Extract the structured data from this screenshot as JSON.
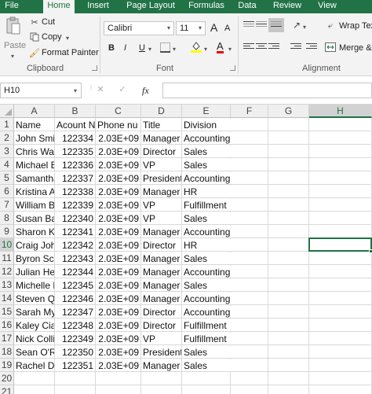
{
  "ribbon_tabs": [
    {
      "label": "File",
      "active": false
    },
    {
      "label": "Home",
      "active": true
    },
    {
      "label": "Insert",
      "active": false
    },
    {
      "label": "Page Layout",
      "active": false
    },
    {
      "label": "Formulas",
      "active": false
    },
    {
      "label": "Data",
      "active": false
    },
    {
      "label": "Review",
      "active": false
    },
    {
      "label": "View",
      "active": false
    }
  ],
  "clipboard": {
    "paste": "Paste",
    "cut": "Cut",
    "copy": "Copy",
    "format_painter": "Format Painter",
    "group_label": "Clipboard"
  },
  "font": {
    "name": "Calibri",
    "size": "11",
    "bold": "B",
    "italic": "I",
    "underline": "U",
    "grow": "A",
    "shrink": "A",
    "font_color_glyph": "A",
    "group_label": "Font"
  },
  "alignment": {
    "wrap_text": "Wrap Tex",
    "merge": "Merge &",
    "group_label": "Alignment"
  },
  "formula_bar": {
    "name_box": "H10",
    "fx": "fx",
    "formula": ""
  },
  "accent": "#217346",
  "columns": [
    "A",
    "B",
    "C",
    "D",
    "E",
    "F",
    "G",
    "H"
  ],
  "selected": {
    "column": "H",
    "row": "10"
  },
  "rows": [
    {
      "num": "1",
      "cells": [
        "Name",
        "Acount Nu",
        "Phone nu",
        "Title",
        "Division"
      ]
    },
    {
      "num": "2",
      "cells": [
        "John Smit",
        "122334",
        "2.03E+09",
        "Manager",
        "Accounting"
      ]
    },
    {
      "num": "3",
      "cells": [
        "Chris Walt",
        "122335",
        "2.03E+09",
        "Director",
        "Sales"
      ]
    },
    {
      "num": "4",
      "cells": [
        "Michael B",
        "122336",
        "2.03E+09",
        "VP",
        "Sales"
      ]
    },
    {
      "num": "5",
      "cells": [
        "Samantha",
        "122337",
        "2.03E+09",
        "President",
        "Accounting"
      ]
    },
    {
      "num": "6",
      "cells": [
        "Kristina Ai",
        "122338",
        "2.03E+09",
        "Manager",
        "HR"
      ]
    },
    {
      "num": "7",
      "cells": [
        "William Bi",
        "122339",
        "2.03E+09",
        "VP",
        "Fulfillment"
      ]
    },
    {
      "num": "8",
      "cells": [
        "Susan Bail",
        "122340",
        "2.03E+09",
        "VP",
        "Sales"
      ]
    },
    {
      "num": "9",
      "cells": [
        "Sharon Ke",
        "122341",
        "2.03E+09",
        "Manager",
        "Accounting"
      ]
    },
    {
      "num": "10",
      "cells": [
        "Craig John",
        "122342",
        "2.03E+09",
        "Director",
        "HR"
      ]
    },
    {
      "num": "11",
      "cells": [
        "Byron Sch",
        "122343",
        "2.03E+09",
        "Manager",
        "Sales"
      ]
    },
    {
      "num": "12",
      "cells": [
        "Julian Her",
        "122344",
        "2.03E+09",
        "Manager",
        "Accounting"
      ]
    },
    {
      "num": "13",
      "cells": [
        "Michelle H",
        "122345",
        "2.03E+09",
        "Manager",
        "Sales"
      ]
    },
    {
      "num": "14",
      "cells": [
        "Steven Qu",
        "122346",
        "2.03E+09",
        "Manager",
        "Accounting"
      ]
    },
    {
      "num": "15",
      "cells": [
        "Sarah Mye",
        "122347",
        "2.03E+09",
        "Director",
        "Accounting"
      ]
    },
    {
      "num": "16",
      "cells": [
        "Kaley Ciar",
        "122348",
        "2.03E+09",
        "Director",
        "Fulfillment"
      ]
    },
    {
      "num": "17",
      "cells": [
        "Nick Collin",
        "122349",
        "2.03E+09",
        "VP",
        "Fulfillment"
      ]
    },
    {
      "num": "18",
      "cells": [
        "Sean O'Re",
        "122350",
        "2.03E+09",
        "President",
        "Sales"
      ]
    },
    {
      "num": "19",
      "cells": [
        "Rachel Da",
        "122351",
        "2.03E+09",
        "Manager",
        "Sales"
      ]
    },
    {
      "num": "20",
      "cells": [
        "",
        "",
        "",
        "",
        ""
      ]
    },
    {
      "num": "21",
      "cells": [
        "",
        "",
        "",
        "",
        ""
      ]
    }
  ]
}
